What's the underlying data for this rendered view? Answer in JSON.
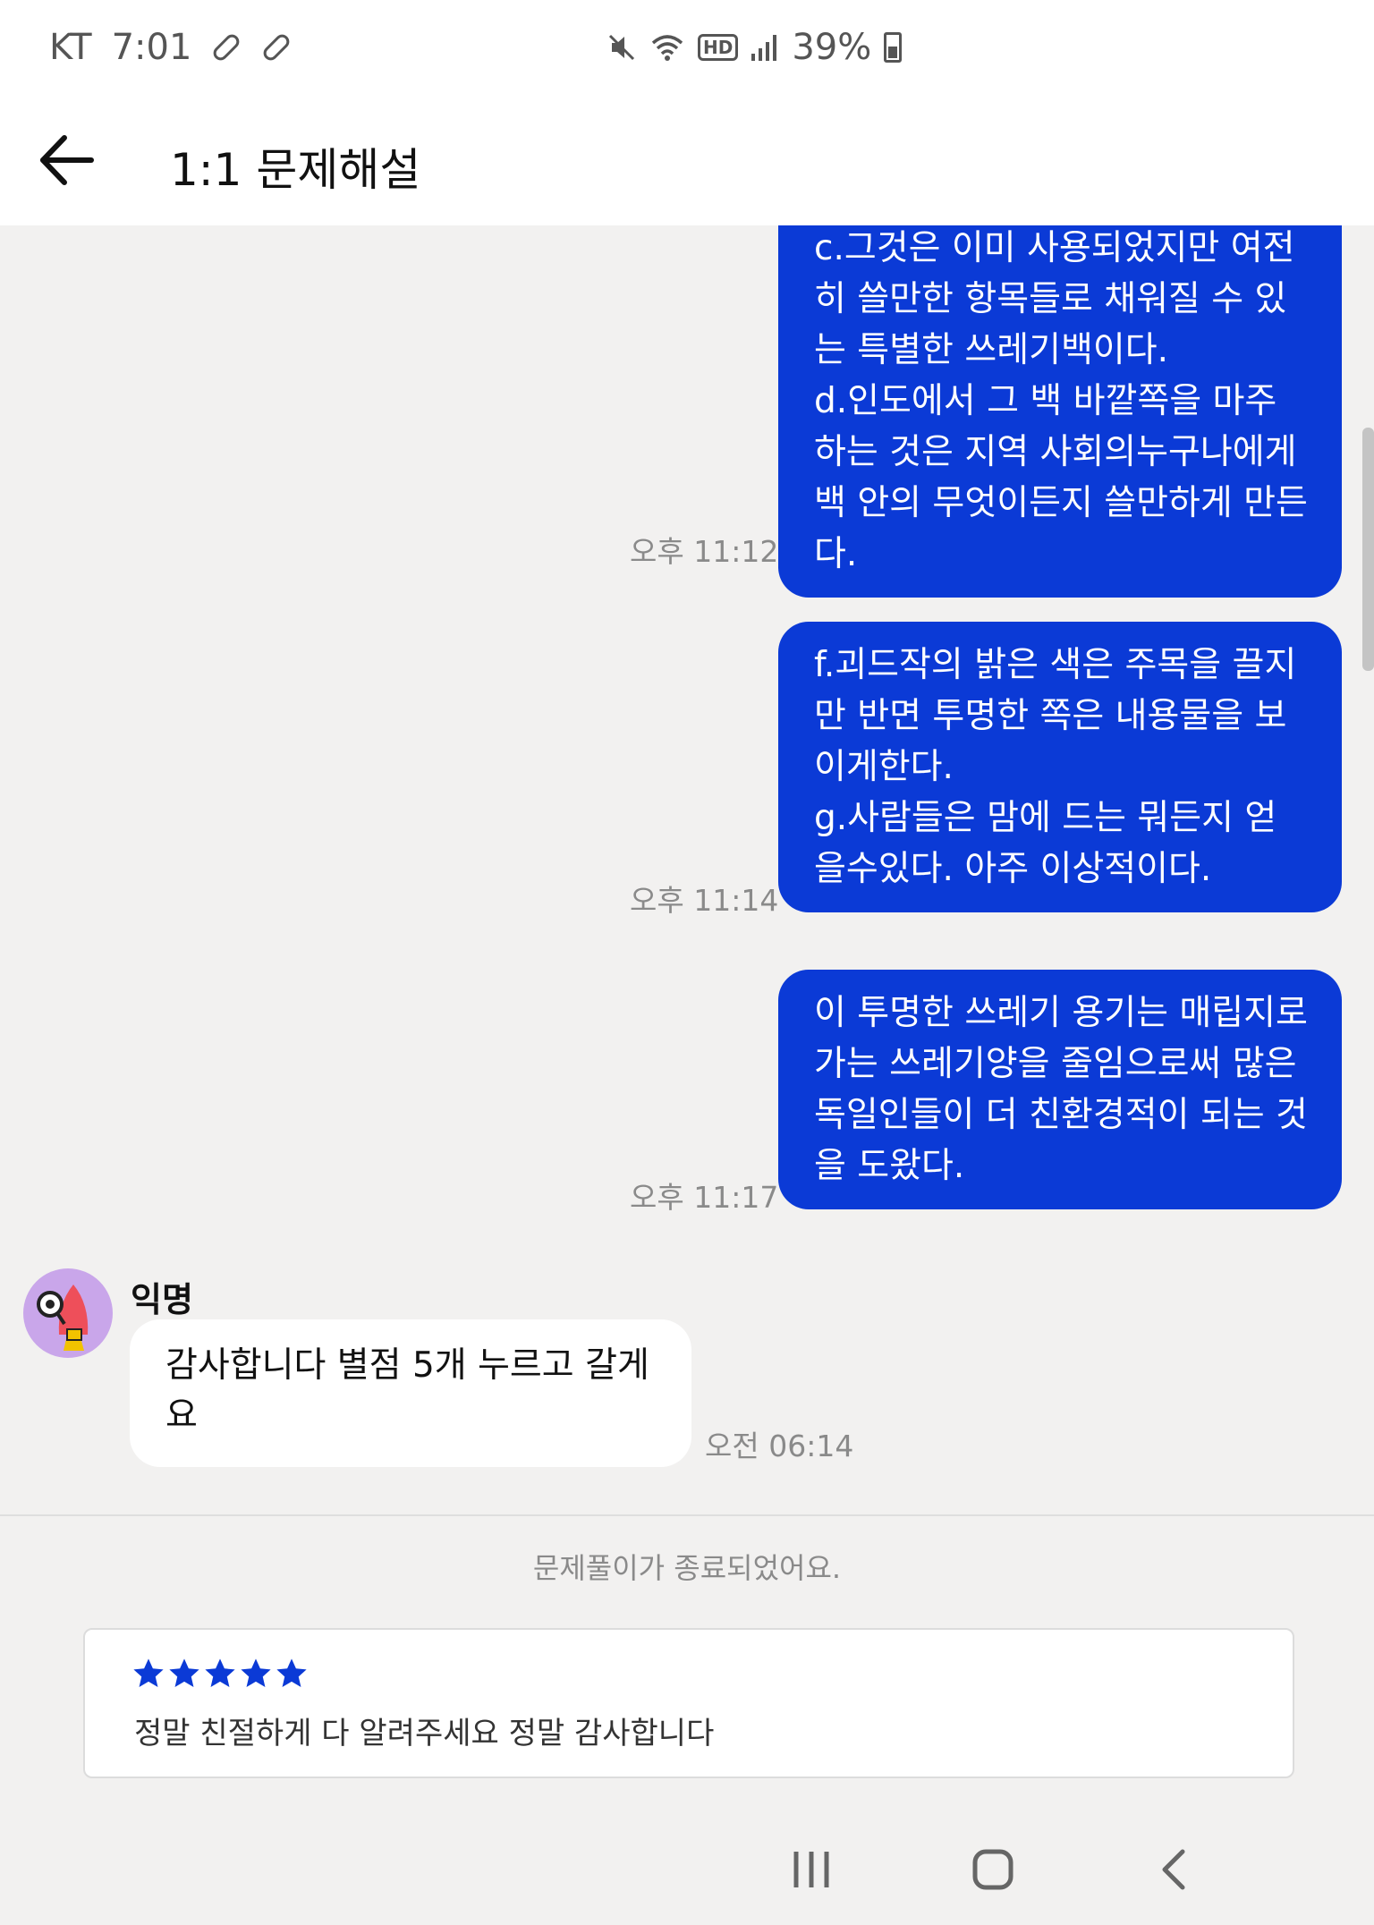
{
  "status_bar": {
    "carrier": "KT",
    "time": "7:01",
    "battery_percent": "39%",
    "icons": [
      "pill-icon",
      "pill-icon",
      "mute-icon",
      "wifi-icon",
      "hd-icon",
      "signal-icon",
      "battery-charging-icon"
    ]
  },
  "header": {
    "title": "1:1 문제해설",
    "back_icon": "arrow-left-icon"
  },
  "messages": [
    {
      "from": "me",
      "text": "이다.\nc.그것은 이미 사용되었지만 여전히 쓸만한 항목들로 채워질 수 있는 특별한 쓰레기백이다.\nd.인도에서 그 백 바깥쪽을 마주하는 것은 지역 사회의누구나에게 백 안의 무엇이든지 쓸만하게 만든다.",
      "time": "오후 11:12"
    },
    {
      "from": "me",
      "text": "f.괴드작의 밝은 색은 주목을 끌지만 반면 투명한 쪽은 내용물을 보이게한다.\ng.사람들은 맘에 드는 뭐든지 얻을수있다. 아주 이상적이다.",
      "time": "오후 11:14"
    },
    {
      "from": "me",
      "text": "이 투명한 쓰레기 용기는 매립지로 가는 쓰레기양을 줄임으로써 많은 독일인들이 더 친환경적이 되는 것을 도왔다.",
      "time": "오후 11:17"
    },
    {
      "from": "other",
      "sender": "익명",
      "text": "감사합니다 별점 5개 누르고 갈게요",
      "time": "오전 06:14"
    }
  ],
  "footer": {
    "ended_notice": "문제풀이가 종료되었어요.",
    "review": {
      "stars": 5,
      "max_stars": 5,
      "text": "정말 친절하게 다 알려주세요 정말 감사합니다"
    }
  },
  "nav_bar": {
    "icons": [
      "recent-apps-icon",
      "home-icon",
      "back-icon"
    ]
  },
  "colors": {
    "accent": "#0b3ad6",
    "background": "#f2f1f0",
    "time_text": "#8a8a8a"
  }
}
